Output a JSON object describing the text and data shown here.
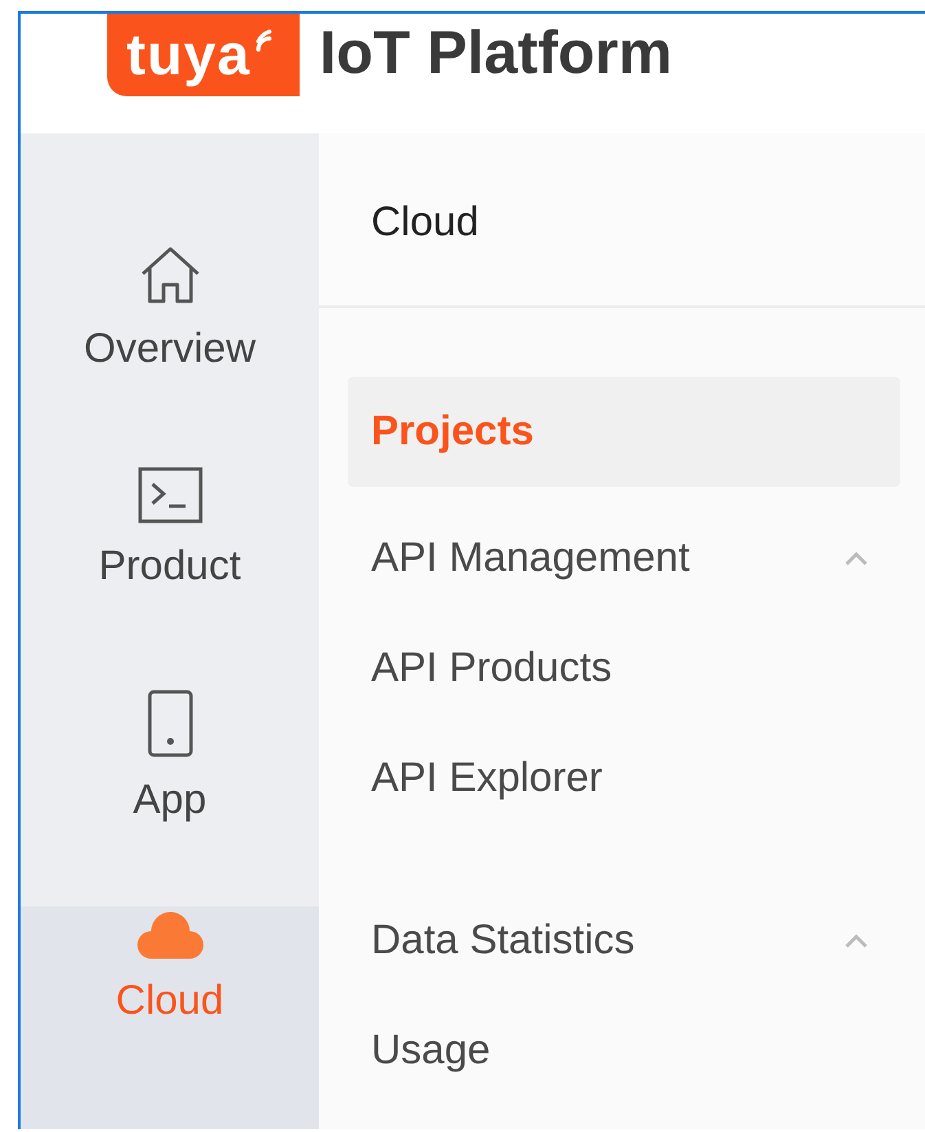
{
  "header": {
    "logo_text": "tuya",
    "title": "IoT Platform"
  },
  "nav": [
    {
      "kind": "home",
      "label": "Overview",
      "selected": false
    },
    {
      "kind": "terminal",
      "label": "Product",
      "selected": false
    },
    {
      "kind": "phone",
      "label": "App",
      "selected": false
    },
    {
      "kind": "cloud",
      "label": "Cloud",
      "selected": true
    }
  ],
  "panel": {
    "title": "Cloud",
    "menu": [
      {
        "kind": "item",
        "label": "Projects",
        "selected": true
      },
      {
        "kind": "group",
        "label": "API Management",
        "expanded": true,
        "children": [
          {
            "label": "API Products",
            "selected": false
          },
          {
            "label": "API Explorer",
            "selected": false
          }
        ]
      },
      {
        "kind": "group",
        "label": "Data Statistics",
        "expanded": true,
        "children": [
          {
            "label": "Usage",
            "selected": false
          }
        ]
      }
    ]
  }
}
